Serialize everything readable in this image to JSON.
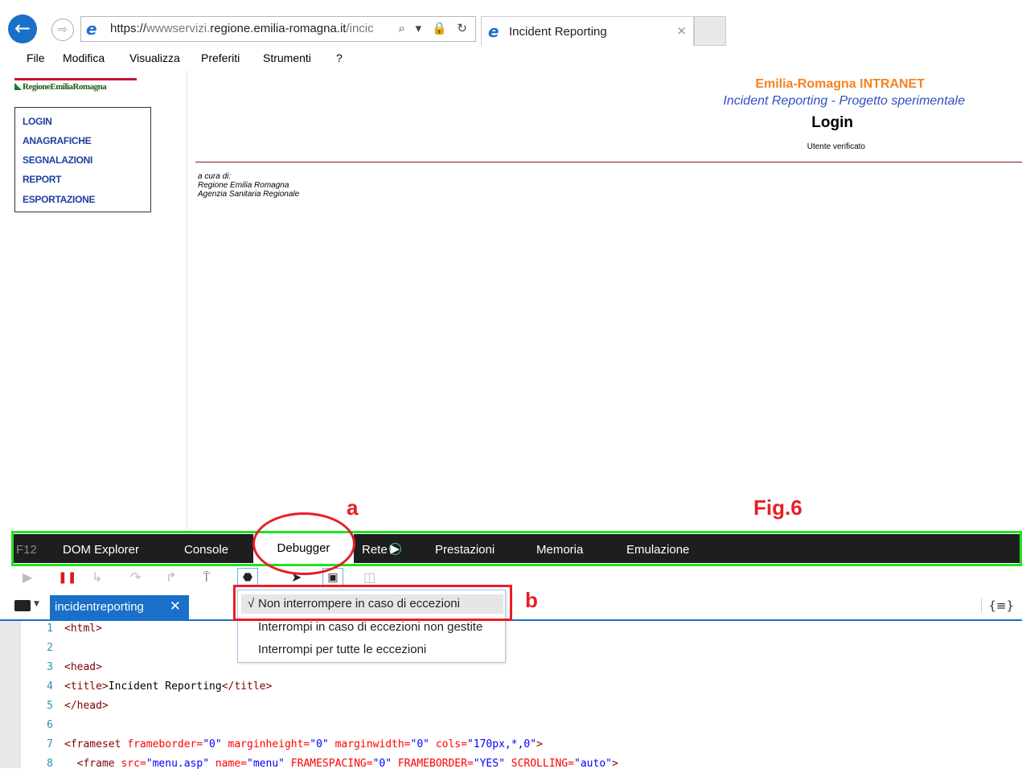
{
  "browser": {
    "url_scheme": "https://",
    "url_dim_part": "wwwservizi.",
    "url_main": "regione.emilia-romagna.it",
    "url_tail": "/incic",
    "address_icons": "⌕ ▾ 🔒 ↻",
    "tab_title": "Incident Reporting",
    "tab_close": "×",
    "menu": [
      "File",
      "Modifica",
      "Visualizza",
      "Preferiti",
      "Strumenti",
      "?"
    ]
  },
  "site": {
    "logo_text": "RegioneEmiliaRomagna",
    "nav": [
      "LOGIN",
      "ANAGRAFICHE",
      "SEGNALAZIONI",
      "REPORT",
      "ESPORTAZIONE"
    ],
    "header_title": "Emilia-Romagna INTRANET",
    "header_subtitle": "Incident Reporting - Progetto sperimentale",
    "page_heading": "Login",
    "status": "Utente verificato",
    "credits": [
      "a cura di:",
      "Regione Emilia Romagna",
      "Agenzia Sanitaria Regionale"
    ]
  },
  "annotations": {
    "a": "a",
    "b": "b",
    "figure": "Fig.6"
  },
  "devtools": {
    "f12": "F12",
    "tabs": [
      "DOM Explorer",
      "Console",
      "Debugger",
      "Rete",
      "Prestazioni",
      "Memoria",
      "Emulazione"
    ],
    "active_tab": "Debugger",
    "file_tab": "incidentreporting",
    "file_tab_close": "✕",
    "exceptions_menu": [
      {
        "label": "Non interrompere in caso di eccezioni",
        "checked": true
      },
      {
        "label": "Interrompi in caso di eccezioni non gestite",
        "checked": false
      },
      {
        "label": "Interrompi per tutte le eccezioni",
        "checked": false
      }
    ],
    "checkmark": "√",
    "code_lines": [
      {
        "n": "1",
        "parts": [
          [
            "tg",
            "<html>"
          ]
        ]
      },
      {
        "n": "2",
        "parts": []
      },
      {
        "n": "3",
        "parts": [
          [
            "tg",
            "<head>"
          ]
        ]
      },
      {
        "n": "4",
        "parts": [
          [
            "tg",
            "<title>"
          ],
          [
            "tx",
            "Incident Reporting"
          ],
          [
            "tg",
            "</title>"
          ]
        ]
      },
      {
        "n": "5",
        "parts": [
          [
            "tg",
            "</head>"
          ]
        ]
      },
      {
        "n": "6",
        "parts": []
      },
      {
        "n": "7",
        "parts": [
          [
            "tg",
            "<frameset "
          ],
          [
            "at",
            "frameborder="
          ],
          [
            "vl",
            "\"0\" "
          ],
          [
            "at",
            "marginheight="
          ],
          [
            "vl",
            "\"0\" "
          ],
          [
            "at",
            "marginwidth="
          ],
          [
            "vl",
            "\"0\" "
          ],
          [
            "at",
            "cols="
          ],
          [
            "vl",
            "\"170px,*,0\""
          ],
          [
            "tg",
            ">"
          ]
        ]
      },
      {
        "n": "8",
        "parts": [
          [
            "tx",
            "  "
          ],
          [
            "tg",
            "<frame "
          ],
          [
            "at",
            "src="
          ],
          [
            "vl",
            "\"menu.asp\" "
          ],
          [
            "at",
            "name="
          ],
          [
            "vl",
            "\"menu\" "
          ],
          [
            "at",
            "FRAMESPACING="
          ],
          [
            "vl",
            "\"0\" "
          ],
          [
            "at",
            "FRAMEBORDER="
          ],
          [
            "vl",
            "\"YES\" "
          ],
          [
            "at",
            "SCROLLING="
          ],
          [
            "vl",
            "\"auto\""
          ],
          [
            "tg",
            ">"
          ]
        ]
      }
    ]
  },
  "colors": {
    "annotation_red": "#e81e25",
    "annotation_green": "#22e022",
    "link_blue": "#1f3fa0",
    "title_orange": "#f5821f",
    "accent_blue": "#1a6fc9"
  }
}
